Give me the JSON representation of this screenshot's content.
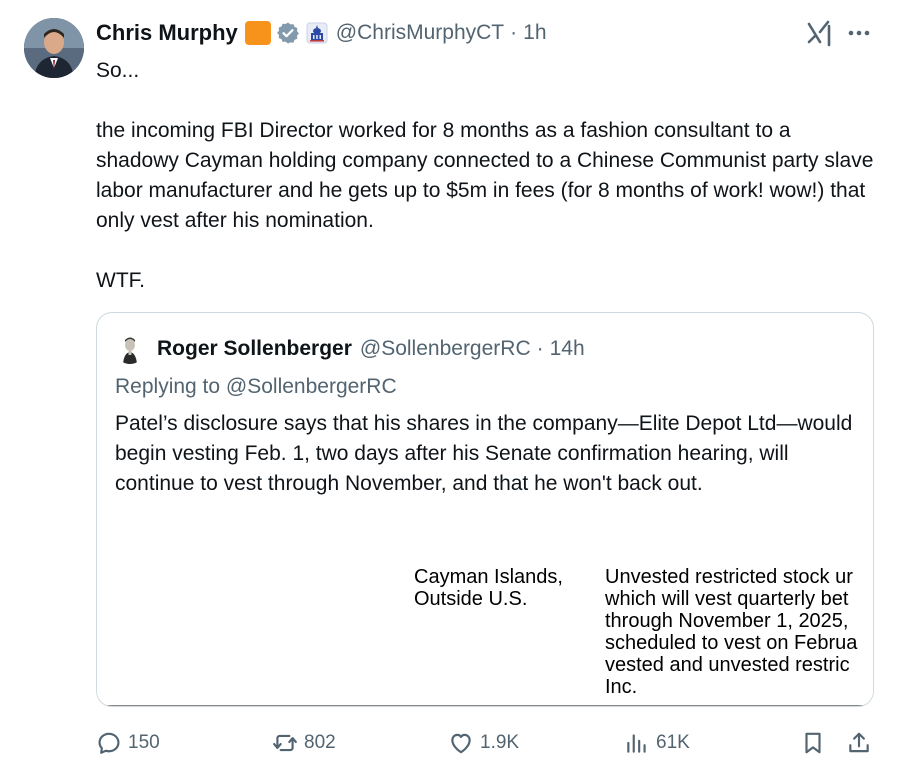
{
  "tweet": {
    "author_name": "Chris Murphy",
    "handle": "@ChrisMurphyCT",
    "separator": "·",
    "time": "1h",
    "text": "So...\n\nthe incoming FBI Director worked for 8 months as a fashion consultant to a shadowy Cayman holding company connected to a Chinese Communist party slave labor manufacturer and he gets up to $5m in fees (for 8 months of work! wow!) that only vest after his nomination.\n\nWTF."
  },
  "quote": {
    "author_name": "Roger Sollenberger",
    "handle": "@SollenbergerRC",
    "separator": "·",
    "time": "14h",
    "replying_to": "Replying to @SollenbergerRC",
    "text": "Patel’s disclosure says that his shares in the company—Elite Depot Ltd—would begin vesting Feb. 1, two days after his Senate confirmation hearing, will continue to vest through November, and that he won't back out.",
    "document": {
      "col1_line1": "Cayman Islands,",
      "col1_line2": "Outside U.S.",
      "col2_line1": "Unvested restricted stock ur",
      "col2_line2": "which will vest quarterly bet",
      "col2_line3": "through November 1, 2025,",
      "col2_line4": "scheduled to vest on Februa",
      "col2_line5": "vested and unvested restric",
      "col2_line6": "Inc."
    }
  },
  "actions": {
    "replies": "150",
    "reposts": "802",
    "likes": "1.9K",
    "views": "61K"
  },
  "icons": {
    "flag_badge_color": "#f7931a",
    "verified_color": "#829aab",
    "secondary_text_color": "#536471"
  }
}
